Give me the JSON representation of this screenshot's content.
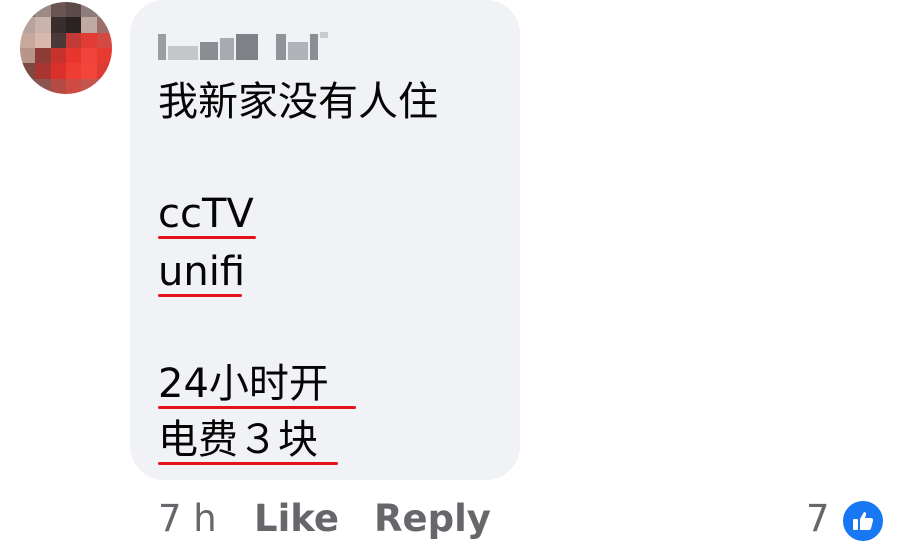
{
  "comment": {
    "author_name": "Linda Lai",
    "lines": [
      "我新家没有人住",
      "ccTV",
      "unifi",
      "24小时开",
      "电费３块"
    ]
  },
  "actions": {
    "time": "7 h",
    "like_label": "Like",
    "reply_label": "Reply"
  },
  "reactions": {
    "count": "7",
    "icon": "thumbs-up-icon",
    "color": "#1877f2"
  },
  "colors": {
    "bubble": "#f0f2f5",
    "underline": "#e4131b",
    "muted": "#65676b"
  }
}
